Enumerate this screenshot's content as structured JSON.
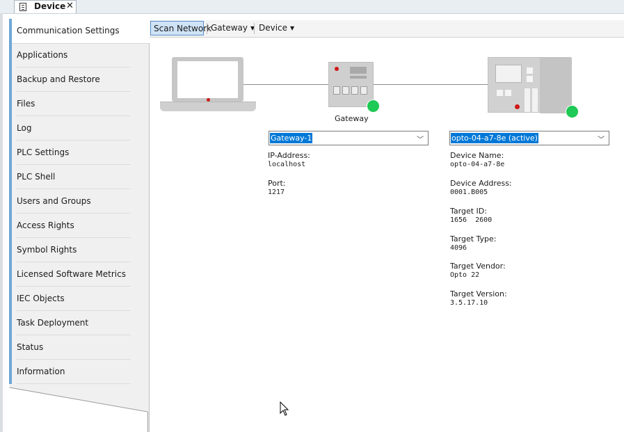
{
  "document_tab": {
    "title": "Device",
    "close_label": "✕"
  },
  "sidebar": {
    "items": [
      {
        "label": "Communication Settings",
        "active": true
      },
      {
        "label": "Applications"
      },
      {
        "label": "Backup and Restore"
      },
      {
        "label": "Files"
      },
      {
        "label": "Log"
      },
      {
        "label": "PLC Settings"
      },
      {
        "label": "PLC Shell"
      },
      {
        "label": "Users and Groups"
      },
      {
        "label": "Access Rights"
      },
      {
        "label": "Symbol Rights"
      },
      {
        "label": "Licensed Software Metrics"
      },
      {
        "label": "IEC Objects"
      },
      {
        "label": "Task Deployment"
      },
      {
        "label": "Status"
      },
      {
        "label": "Information"
      }
    ]
  },
  "toolbar": {
    "scan_label": "Scan Network",
    "gateway_label": "Gateway",
    "device_label": "Device"
  },
  "diagram": {
    "gateway_label": "Gateway",
    "status_color": "#1ec955"
  },
  "gateway": {
    "selected": "Gateway-1",
    "fields": [
      {
        "label": "IP-Address:",
        "value": "localhost"
      },
      {
        "label": "Port:",
        "value": "1217"
      }
    ]
  },
  "device": {
    "selected": "opto-04-a7-8e (active)",
    "fields": [
      {
        "label": "Device Name:",
        "value": "opto-04-a7-8e"
      },
      {
        "label": "Device Address:",
        "value": "0001.B005"
      },
      {
        "label": "Target ID:",
        "value": "1656  2600"
      },
      {
        "label": "Target Type:",
        "value": "4096"
      },
      {
        "label": "Target Vendor:",
        "value": "Opto 22"
      },
      {
        "label": "Target Version:",
        "value": "3.5.17.10"
      }
    ]
  }
}
